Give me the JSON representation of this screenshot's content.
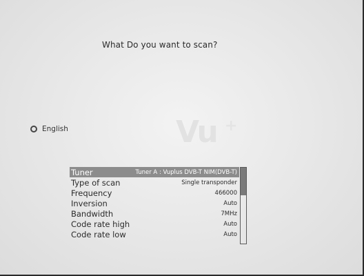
{
  "header": {
    "title": "What Do you want to scan?"
  },
  "logo": {
    "text": "Vu",
    "mark": "+"
  },
  "language": {
    "label": "English",
    "icon": "radio-circle-icon"
  },
  "config": {
    "rows": [
      {
        "label": "Tuner",
        "value": "Tuner A : Vuplus DVB-T NIM(DVB-T)",
        "selected": true
      },
      {
        "label": "Type of scan",
        "value": "Single transponder",
        "selected": false
      },
      {
        "label": "Frequency",
        "value": "466000",
        "selected": false
      },
      {
        "label": "Inversion",
        "value": "Auto",
        "selected": false
      },
      {
        "label": "Bandwidth",
        "value": "7MHz",
        "selected": false
      },
      {
        "label": "Code rate high",
        "value": "Auto",
        "selected": false
      },
      {
        "label": "Code rate low",
        "value": "Auto",
        "selected": false
      }
    ],
    "scroll_fraction_visible": 0.36
  },
  "colors": {
    "selected_row_bg": "#8c8c8c",
    "text": "#2a2a2a",
    "background": "#e9e9e9"
  }
}
